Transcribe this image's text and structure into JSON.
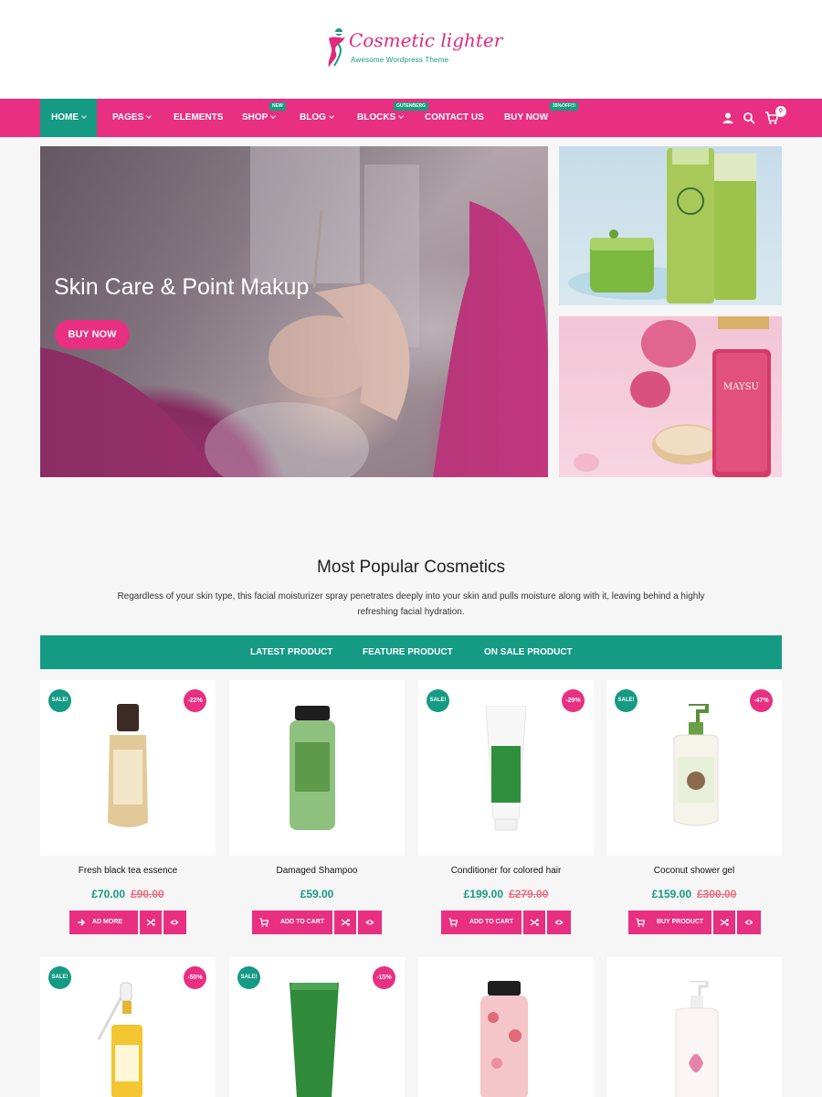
{
  "brand": {
    "name": "Cosmetic lighter",
    "tagline": "Awesome Wordpress Theme",
    "pink": "#e82f81",
    "teal": "#159a84"
  },
  "nav": {
    "items": [
      {
        "label": "HOME",
        "dropdown": true,
        "active": true
      },
      {
        "label": "PAGES",
        "dropdown": true
      },
      {
        "label": "ELEMENTS",
        "dropdown": false
      },
      {
        "label": "SHOP",
        "dropdown": true,
        "badge": "NEW"
      },
      {
        "label": "BLOG",
        "dropdown": true
      },
      {
        "label": "BLOCKS",
        "dropdown": true,
        "badge": "GUTENBERG"
      },
      {
        "label": "CONTACT US",
        "dropdown": false
      },
      {
        "label": "BUY NOW",
        "dropdown": false,
        "badge": "35%OFF!!!"
      }
    ],
    "icons": [
      "user-icon",
      "search-icon",
      "cart-icon"
    ],
    "cart_count": "0"
  },
  "hero": {
    "title": "Skin Care & Point Makup",
    "button": "BUY NOW"
  },
  "side_banners": [
    {
      "label": "",
      "product": "green-cosmetics"
    },
    {
      "label": "MAYSU",
      "product": "rose-toner"
    }
  ],
  "section": {
    "title": "Most Popular Cosmetics",
    "description": "Regardless of your skin type, this facial moisturizer spray penetrates deeply into your skin and pulls moisture along with it, leaving behind a highly refreshing facial hydration."
  },
  "tabs": [
    "LATEST PRODUCT",
    "FEATURE PRODUCT",
    "ON SALE PRODUCT"
  ],
  "active_tab": "LATEST PRODUCT",
  "products": [
    {
      "name": "Fresh black tea essence",
      "price": "£70.00",
      "old_price": "£90.00",
      "sale": "SALE!",
      "discount": "-22%",
      "action": "AD MORE",
      "action_icon": "external-icon"
    },
    {
      "name": "Damaged Shampoo",
      "price": "£59.00",
      "old_price": "",
      "sale": "",
      "discount": "",
      "action": "ADD TO CART",
      "action_icon": "cart-icon"
    },
    {
      "name": "Conditioner for colored hair",
      "price": "£199.00",
      "old_price": "£279.00",
      "sale": "SALE!",
      "discount": "-29%",
      "action": "ADD TO CART",
      "action_icon": "cart-icon"
    },
    {
      "name": "Coconut shower gel",
      "price": "£159.00",
      "old_price": "£300.00",
      "sale": "SALE!",
      "discount": "-47%",
      "action": "BUY PRODUCT",
      "action_icon": "cart-icon"
    },
    {
      "name": "",
      "sale": "SALE!",
      "discount": "-50%"
    },
    {
      "name": "",
      "sale": "SALE!",
      "discount": "-15%"
    },
    {
      "name": "",
      "sale": "",
      "discount": ""
    },
    {
      "name": "",
      "sale": "",
      "discount": ""
    }
  ]
}
